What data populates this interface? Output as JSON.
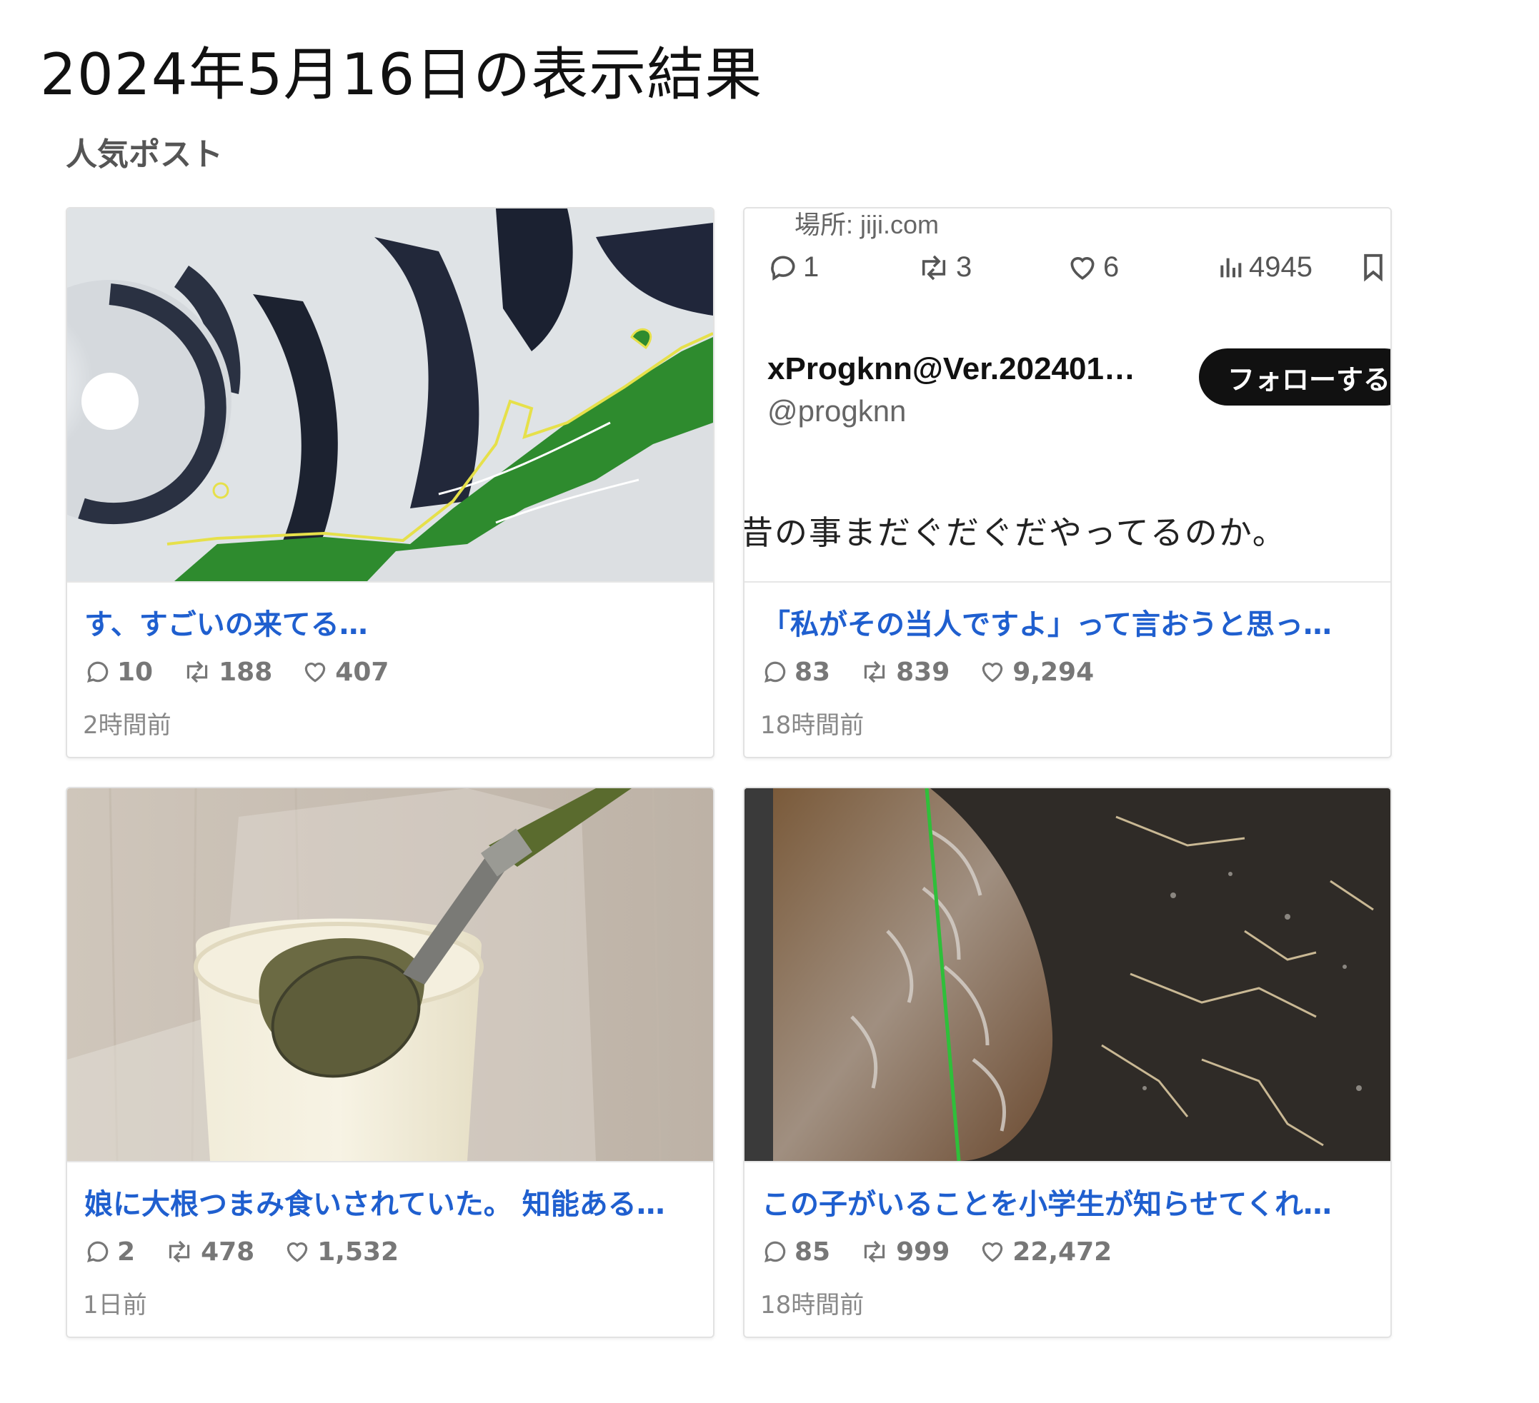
{
  "page": {
    "title": "2024年5月16日の表示結果"
  },
  "section": {
    "title": "人気ポスト"
  },
  "posts": [
    {
      "title": "す、すごいの来てる…",
      "replies": "10",
      "reposts": "188",
      "likes": "407",
      "time": "2時間前",
      "thumbnail": "satellite-cloud-image"
    },
    {
      "title": "「私がその当人ですよ」って言おうと思っ…",
      "replies": "83",
      "reposts": "839",
      "likes": "9,294",
      "time": "18時間前",
      "thumbnail": "embedded-tweet-screenshot",
      "embed": {
        "location": "場所: jiji.com",
        "reply_count": "1",
        "repost_count": "3",
        "like_count": "6",
        "view_count": "4945",
        "author_name": "xProgknn@Ver.202401…",
        "author_handle": "@progknn",
        "follow_label": "フォローする",
        "text_line": "昔の事まだぐだぐだやってるのか。"
      }
    },
    {
      "title": "娘に大根つまみ食いされていた。 知能ある…",
      "replies": "2",
      "reposts": "478",
      "likes": "1,532",
      "time": "1日前",
      "thumbnail": "daikon-with-spoon-photo"
    },
    {
      "title": "この子がいることを小学生が知らせてくれ…",
      "replies": "85",
      "reposts": "999",
      "likes": "22,472",
      "time": "18時間前",
      "thumbnail": "wet-animal-photo"
    }
  ],
  "colors": {
    "link": "#1f5fcf",
    "meta": "#777777",
    "border": "#e2e2e2"
  }
}
